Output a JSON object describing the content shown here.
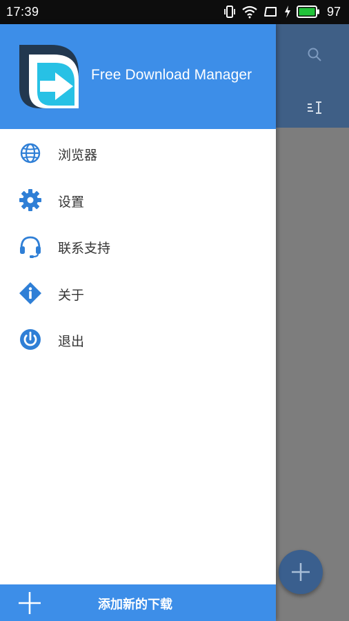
{
  "status_bar": {
    "time": "17:39",
    "battery_level": "97",
    "icons": [
      "vibrate-icon",
      "wifi-icon",
      "screen-rotate-icon",
      "charging-icon",
      "battery-icon"
    ]
  },
  "drawer": {
    "app_title": "Free Download Manager",
    "logo_icon": "fdm-logo-icon",
    "items": [
      {
        "label": "浏览器",
        "icon": "globe-icon"
      },
      {
        "label": "设置",
        "icon": "gear-icon"
      },
      {
        "label": "联系支持",
        "icon": "headset-icon"
      },
      {
        "label": "关于",
        "icon": "info-icon"
      },
      {
        "label": "退出",
        "icon": "power-icon"
      }
    ],
    "add_download_label": "添加新的下载",
    "add_icon": "plus-icon"
  },
  "background_app": {
    "icons": [
      "search-icon",
      "sort-icon",
      "plus-icon"
    ]
  },
  "colors": {
    "accent": "#3d8ee8",
    "icon_blue": "#2f7fd6",
    "status_bar": "#0d0d0d",
    "overlay_gray": "#7d7d7d"
  }
}
